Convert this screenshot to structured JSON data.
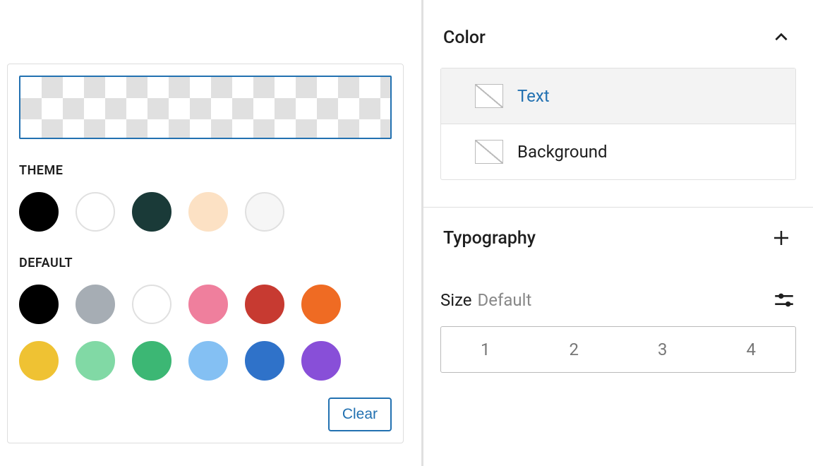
{
  "colorPicker": {
    "themeLabel": "THEME",
    "defaultLabel": "DEFAULT",
    "clearLabel": "Clear",
    "themeColors": [
      "#000000",
      "#ffffff",
      "#1a3a38",
      "#fce1c4",
      "#f6f6f6"
    ],
    "defaultColors": [
      "#000000",
      "#a6adb4",
      "#ffffff",
      "#ef7f9d",
      "#c73a31",
      "#ef6b23",
      "#efc233",
      "#81d9a5",
      "#3cb774",
      "#84c0f3",
      "#2f72c9",
      "#884fd8"
    ]
  },
  "sidebar": {
    "color": {
      "title": "Color",
      "items": {
        "text": "Text",
        "background": "Background"
      }
    },
    "typography": {
      "title": "Typography",
      "sizeLabel": "Size",
      "sizeValue": "Default",
      "sizeOptions": [
        "1",
        "2",
        "3",
        "4"
      ]
    }
  }
}
